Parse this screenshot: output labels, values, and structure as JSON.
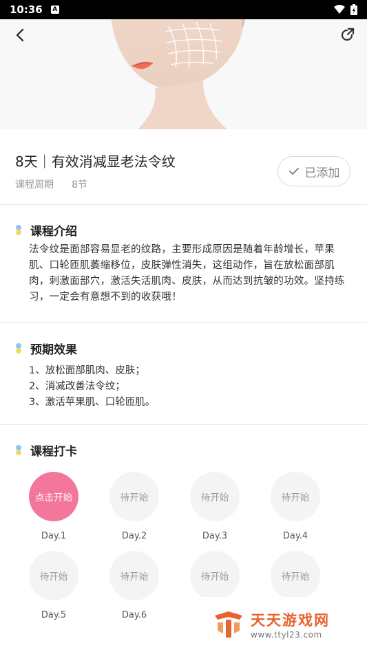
{
  "status_bar": {
    "time": "10:36",
    "badge": "A"
  },
  "course": {
    "title": "8天｜有效消减显老法令纹",
    "period_label": "课程周期",
    "lessons": "8节",
    "added_label": "已添加"
  },
  "intro": {
    "heading": "课程介绍",
    "text": "法令纹是面部容易显老的纹路，主要形成原因是随着年龄增长，苹果肌、口轮匝肌萎缩移位，皮肤弹性消失，这组动作，旨在放松面部肌肉，刺激面部穴，激活失活肌肉、皮肤，从而达到抗皱的功效。坚持练习，一定会有意想不到的收获哦！"
  },
  "effects": {
    "heading": "预期效果",
    "items": [
      "1、放松面部肌肉、皮肤；",
      "2、消减改善法令纹；",
      "3、激活苹果肌、口轮匝肌。"
    ]
  },
  "checkin": {
    "heading": "课程打卡",
    "days": [
      {
        "status": "点击开始",
        "label": "Day.1"
      },
      {
        "status": "待开始",
        "label": "Day.2"
      },
      {
        "status": "待开始",
        "label": "Day.3"
      },
      {
        "status": "待开始",
        "label": "Day.4"
      },
      {
        "status": "待开始",
        "label": "Day.5"
      },
      {
        "status": "待开始",
        "label": "Day.6"
      },
      {
        "status": "待开始",
        "label": ""
      },
      {
        "status": "待开始",
        "label": ""
      }
    ]
  },
  "watermark": {
    "title": "天天游戏网",
    "url": "www.ttyl23.com"
  },
  "colors": {
    "accent": "#f2779a",
    "watermark": "#e8632f"
  }
}
